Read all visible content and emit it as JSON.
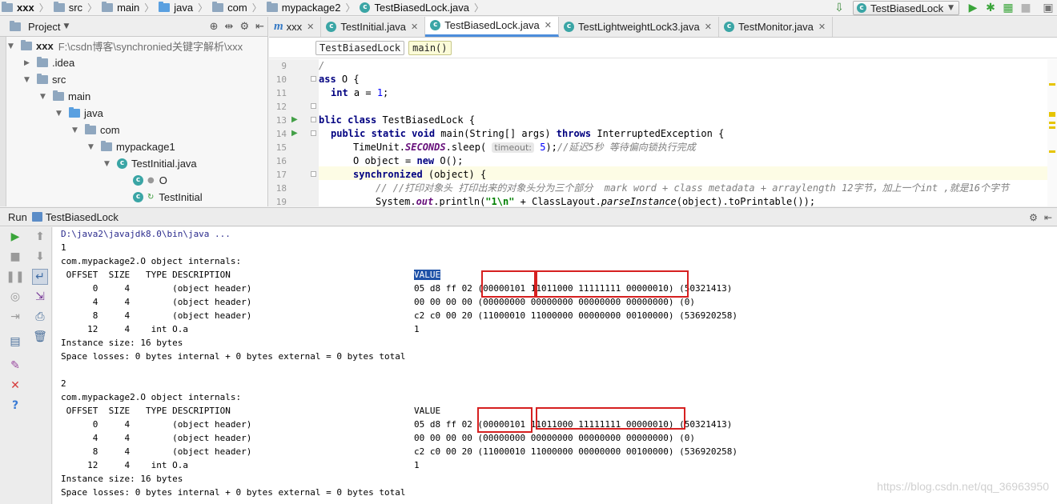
{
  "navbar": {
    "crumbs": [
      "xxx",
      "src",
      "main",
      "java",
      "com",
      "mypackage2",
      "TestBiasedLock.java"
    ],
    "run_config": "TestBiasedLock"
  },
  "project": {
    "title": "Project",
    "tree": [
      {
        "label": "xxx",
        "extra": "F:\\csdn博客\\synchronied关键字解析\\xxx"
      },
      {
        "label": ".idea"
      },
      {
        "label": "src"
      },
      {
        "label": "main"
      },
      {
        "label": "java"
      },
      {
        "label": "com"
      },
      {
        "label": "mypackage1"
      },
      {
        "label": "TestInitial.java"
      },
      {
        "label": "O"
      },
      {
        "label": "TestInitial"
      }
    ]
  },
  "editor": {
    "tabs": [
      "xxx",
      "TestInitial.java",
      "TestBiasedLock.java",
      "TestLightweightLock3.java",
      "TestMonitor.java"
    ],
    "active_tab": "TestBiasedLock.java",
    "breadcrumb": [
      "TestBiasedLock",
      "main()"
    ],
    "line_numbers": [
      "9",
      "10",
      "11",
      "12",
      "13",
      "14",
      "15",
      "16",
      "17",
      "18",
      "19"
    ],
    "code": {
      "l9": "/",
      "l10_kw": "ass",
      "l10_rest": " O {",
      "l11_kw": "int",
      "l11_a": " a = ",
      "l11_num": "1",
      "l11_end": ";",
      "l13_kw": "blic class",
      "l13_rest": " TestBiasedLock {",
      "l14_kw": "public static void",
      "l14_mid": " main(String[] args) ",
      "l14_kw2": "throws",
      "l14_end": " InterruptedException {",
      "l15_a": "TimeUnit.",
      "l15_fld": "SECONDS",
      "l15_b": ".sleep( ",
      "l15_hint": "timeout:",
      "l15_num": " 5",
      "l15_c": ");",
      "l15_cm": "//延迟5秒 等待偏向锁执行完成",
      "l16_a": "O object = ",
      "l16_kw": "new",
      "l16_b": " O();",
      "l17_kw": "synchronized",
      "l17_rest": " (object) {",
      "l18_cm": "// //打印对象头 打印出来的对象头分为三个部分  mark word + class metadata + arraylength 12字节，加上一个int ,就是16个字节",
      "l19_a": "System.",
      "l19_fld": "out",
      "l19_b": ".println(",
      "l19_str": "\"1\\n\"",
      "l19_c": " + ClassLayout.",
      "l19_st": "parseInstance",
      "l19_d": "(object).toPrintable());"
    }
  },
  "run": {
    "label": "Run",
    "config": "TestBiasedLock",
    "console": {
      "cmd": "D:\\java2\\javajdk8.0\\bin\\java ...",
      "block1": {
        "num": "1",
        "title": "com.mypackage2.O object internals:",
        "header": " OFFSET  SIZE   TYPE DESCRIPTION",
        "value_label": "VALUE",
        "rows": [
          {
            "left": "      0     4        (object header)",
            "right": "05 d8 ff 02 (00000101 11011000 11111111 00000010) (50321413)"
          },
          {
            "left": "      4     4        (object header)",
            "right": "00 00 00 00 (00000000 00000000 00000000 00000000) (0)"
          },
          {
            "left": "      8     4        (object header)",
            "right": "c2 c0 00 20 (11000010 11000000 00000000 00100000) (536920258)"
          },
          {
            "left": "     12     4    int O.a",
            "right": "1"
          }
        ],
        "size": "Instance size: 16 bytes",
        "losses": "Space losses: 0 bytes internal + 0 bytes external = 0 bytes total"
      },
      "block2": {
        "num": "2",
        "title": "com.mypackage2.O object internals:",
        "header": " OFFSET  SIZE   TYPE DESCRIPTION",
        "value_label": "VALUE",
        "rows": [
          {
            "left": "      0     4        (object header)",
            "right": "05 d8 ff 02 (00000101 11011000 11111111 00000010) (50321413)"
          },
          {
            "left": "      4     4        (object header)",
            "right": "00 00 00 00 (00000000 00000000 00000000 00000000) (0)"
          },
          {
            "left": "      8     4        (object header)",
            "right": "c2 c0 00 20 (11000010 11000000 00000000 00100000) (536920258)"
          },
          {
            "left": "     12     4    int O.a",
            "right": "1"
          }
        ],
        "size": "Instance size: 16 bytes",
        "losses": "Space losses: 0 bytes internal + 0 bytes external = 0 bytes total"
      }
    }
  },
  "watermark": "https://blog.csdn.net/qq_36963950"
}
